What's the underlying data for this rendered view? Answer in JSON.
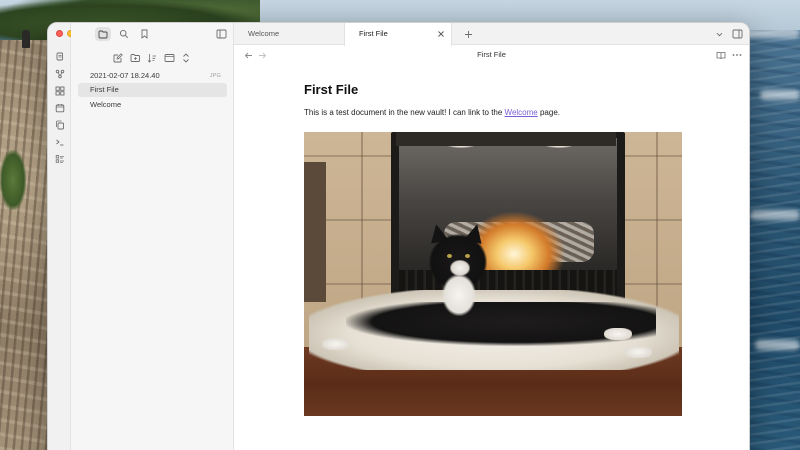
{
  "window": {
    "top_icons": [
      "folder-icon",
      "search-icon",
      "bookmark-icon"
    ],
    "sidebar_toggle_icon": "sidebar-left-icon",
    "right_sidebar_toggle_icon": "sidebar-right-icon"
  },
  "ribbon": {
    "items": [
      "files-icon",
      "graph-icon",
      "canvas-icon",
      "daily-note-icon",
      "copy-icon",
      "command-palette-icon",
      "templates-icon"
    ]
  },
  "file_explorer": {
    "actions": [
      "new-note-icon",
      "new-folder-icon",
      "sort-icon",
      "collapse-icon",
      "expand-icon"
    ],
    "files": [
      {
        "name": "2021-02-07 18.24.40",
        "ext": "JPG",
        "active": false
      },
      {
        "name": "First File",
        "ext": "",
        "active": true
      },
      {
        "name": "Welcome",
        "ext": "",
        "active": false
      }
    ]
  },
  "tabs": [
    {
      "label": "Welcome",
      "active": false
    },
    {
      "label": "First File",
      "active": true
    }
  ],
  "view": {
    "title": "First File"
  },
  "document": {
    "title": "First File",
    "paragraph_before_link": "This is a test document in the new vault! I can link to the ",
    "link_text": "Welcome",
    "paragraph_after_link": " page."
  },
  "colors": {
    "accent_link": "#7b5fd6",
    "traffic_red": "#fe5f57",
    "traffic_yellow": "#febc2e",
    "traffic_green": "#28c840"
  }
}
